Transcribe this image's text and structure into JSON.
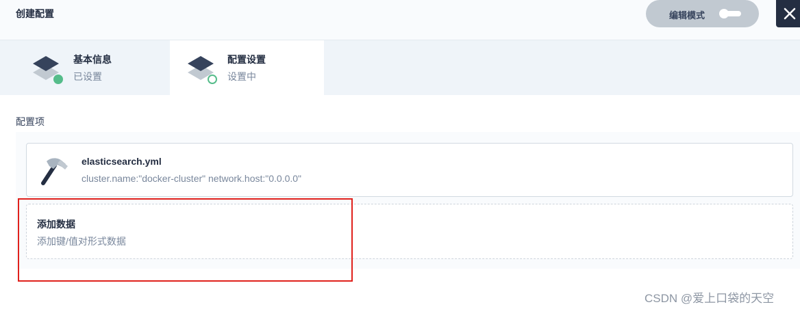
{
  "header": {
    "title": "创建配置",
    "edit_mode_label": "编辑模式",
    "close_icon": "close-icon"
  },
  "steps": [
    {
      "title": "基本信息",
      "status": "已设置",
      "state": "done",
      "icon": "layers-icon"
    },
    {
      "title": "配置设置",
      "status": "设置中",
      "state": "in-progress",
      "icon": "layers-icon"
    }
  ],
  "main": {
    "section_label": "配置项",
    "items": [
      {
        "title": "elasticsearch.yml",
        "description": "cluster.name:\"docker-cluster\" network.host:\"0.0.0.0\"",
        "icon": "hammer-icon"
      }
    ],
    "add_data": {
      "title": "添加数据",
      "description": "添加键/值对形式数据"
    }
  },
  "watermark": "CSDN @爱上口袋的天空",
  "colors": {
    "accent_green": "#55bc8a",
    "dark": "#242e42",
    "highlight_red": "#e0201b"
  }
}
